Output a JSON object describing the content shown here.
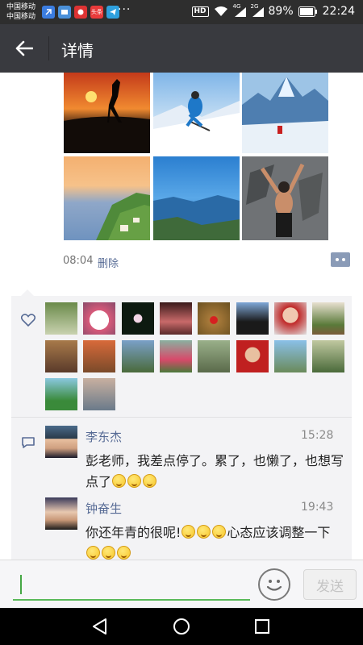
{
  "status_bar": {
    "carrier_1": "中国移动",
    "carrier_2": "中国移动",
    "app_badge": "头条",
    "more_indicator": "···",
    "hd_label": "HD",
    "net_4g": "4G",
    "net_2g": "2G",
    "battery_percent": "89%",
    "time": "22:24"
  },
  "header": {
    "title": "详情",
    "back_icon": "arrow-left-icon"
  },
  "post": {
    "photos": [
      "crane-sunset",
      "skier",
      "ice-climber",
      "lake-vineyard-sunset",
      "lake-alps",
      "rock-climber"
    ],
    "time": "08:04",
    "delete_label": "删除",
    "more_icon": "more-dots-icon"
  },
  "likes": {
    "icon": "heart-outline-icon",
    "avatar_count": 18
  },
  "comments": {
    "icon": "comment-bubble-icon",
    "items": [
      {
        "name": "李东杰",
        "time": "15:28",
        "text": "彭老师，我差点停了。累了，也懒了，也想写点了",
        "emoji_count": 3
      },
      {
        "name": "钟奋生",
        "time": "19:43",
        "text_part1": "你还年青的很呢!",
        "text_part2": "心态应该调整一下",
        "emoji_count_1": 3,
        "emoji_count_2": 3
      }
    ]
  },
  "input": {
    "placeholder": "",
    "emoji_icon": "emoji-face-icon",
    "send_label": "发送"
  },
  "nav": {
    "back_icon": "triangle-back-icon",
    "home_icon": "circle-home-icon",
    "recent_icon": "square-recent-icon"
  },
  "colors": {
    "titlebar_bg": "#393a3f",
    "link_blue": "#576b95",
    "input_underline": "#5aba5a"
  }
}
